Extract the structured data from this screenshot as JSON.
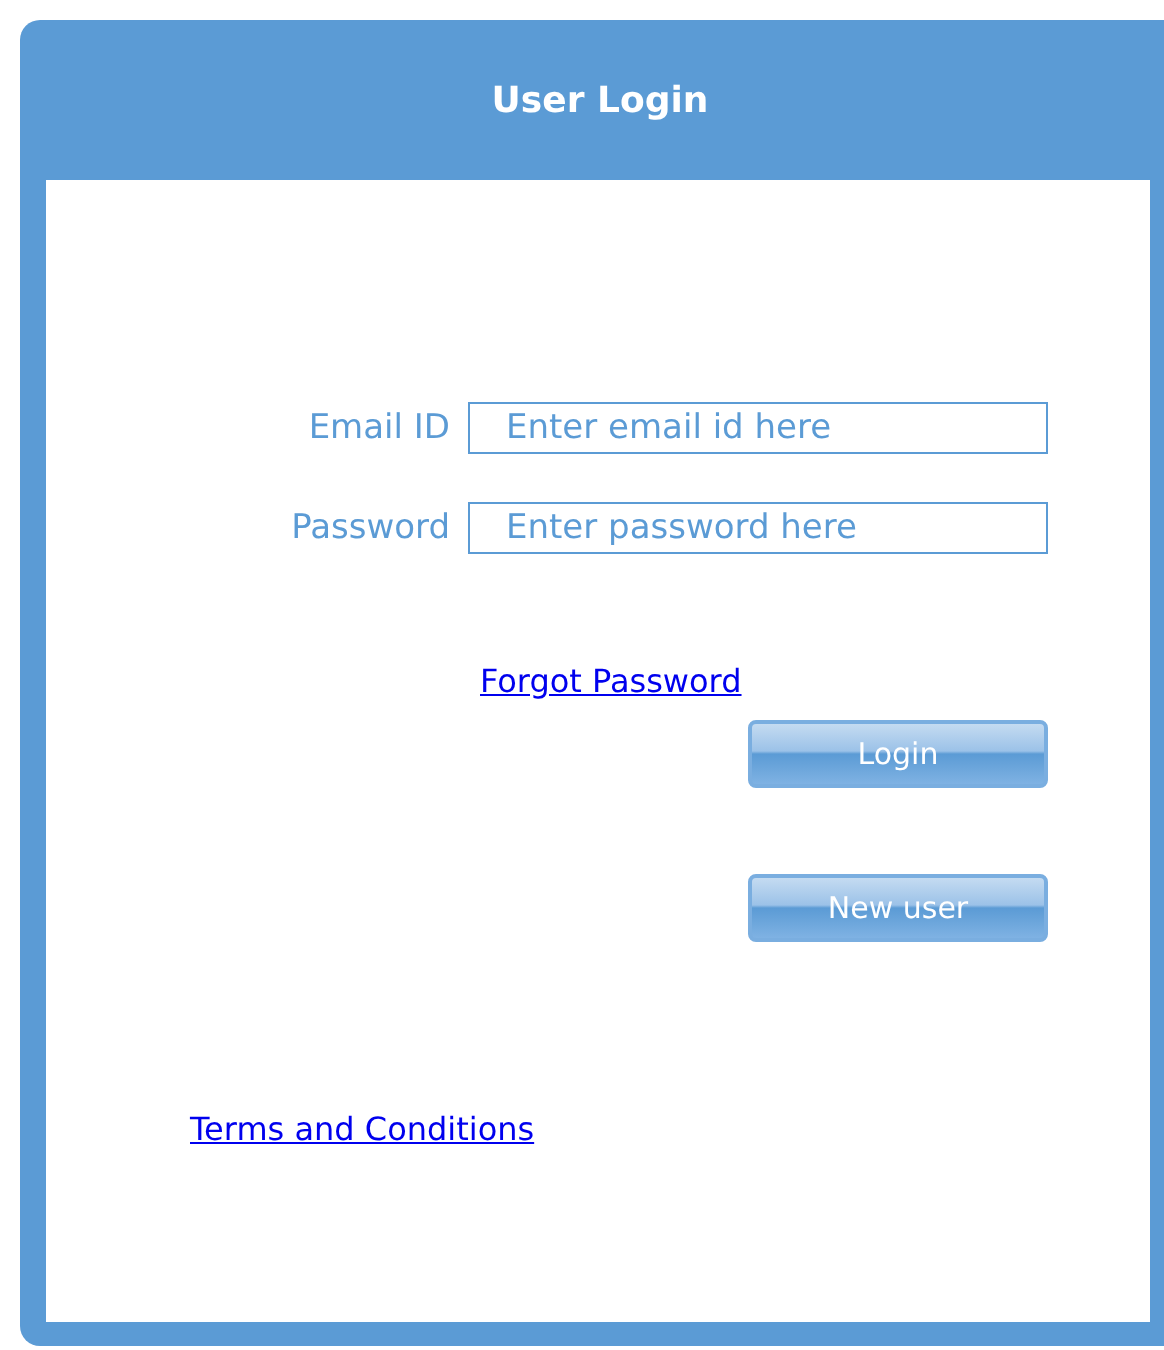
{
  "window": {
    "title": "User Login"
  },
  "fields": [
    {
      "label": "Email ID",
      "placeholder": "Enter email id here"
    },
    {
      "label": "Password",
      "placeholder": "Enter password here"
    }
  ],
  "forgot_link": "Forgot Password",
  "buttons": [
    {
      "label": "Login"
    },
    {
      "label": "New user"
    }
  ],
  "terms_link": "Terms and Conditions"
}
